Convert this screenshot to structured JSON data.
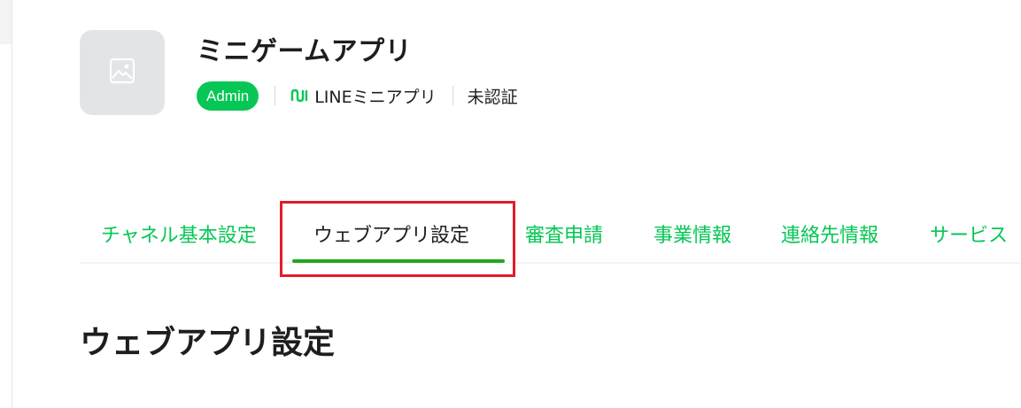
{
  "channel": {
    "name": "ミニゲームアプリ",
    "role_badge": "Admin",
    "type_label": "LINEミニアプリ",
    "verification_status": "未認証",
    "thumbnail_icon": "image-placeholder-icon",
    "type_icon": "line-mini-app-icon"
  },
  "tabs": [
    {
      "label": "チャネル基本設定",
      "active": false
    },
    {
      "label": "ウェブアプリ設定",
      "active": true
    },
    {
      "label": "審査申請",
      "active": false
    },
    {
      "label": "事業情報",
      "active": false
    },
    {
      "label": "連絡先情報",
      "active": false
    },
    {
      "label": "サービス"
    }
  ],
  "section": {
    "title": "ウェブアプリ設定"
  },
  "colors": {
    "brand_green": "#06c755",
    "tab_underline": "#1fa81f",
    "highlight_red": "#e01e2b",
    "thumbnail_bg": "#e3e4e7"
  }
}
